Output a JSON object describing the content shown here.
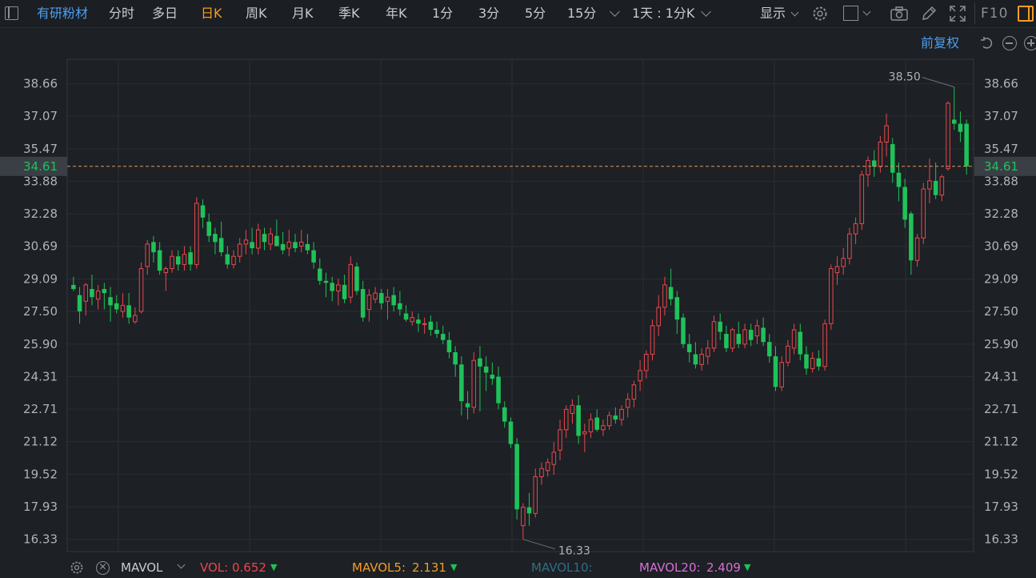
{
  "toolbar": {
    "stock_name": "有研粉材",
    "periods": [
      "分时",
      "多日",
      "日K",
      "周K",
      "月K",
      "季K",
      "年K",
      "1分",
      "3分",
      "5分",
      "15分"
    ],
    "active_period": "日K",
    "interval_select": "1天 : 1分K",
    "display_label": "显示",
    "f10_label": "F10",
    "accent_color": "#f39c27"
  },
  "adjust": {
    "label": "前复权"
  },
  "chart_data": {
    "type": "candlestick",
    "ylim": [
      15.73,
      39.86
    ],
    "y_ticks": [
      "38.66",
      "37.07",
      "35.47",
      "33.88",
      "32.28",
      "30.69",
      "29.09",
      "27.50",
      "25.90",
      "24.31",
      "22.71",
      "21.12",
      "19.52",
      "17.93",
      "16.33"
    ],
    "current_price": "34.61",
    "high_label": "38.50",
    "low_label": "16.33",
    "up_color": "#e8484e",
    "down_color": "#1fc25a",
    "candles": [
      [
        28.8,
        29.2,
        28.5,
        28.6
      ],
      [
        28.3,
        28.7,
        26.9,
        27.5
      ],
      [
        28.0,
        28.9,
        27.3,
        28.8
      ],
      [
        28.6,
        29.3,
        27.8,
        28.2
      ],
      [
        28.1,
        28.8,
        27.6,
        28.5
      ],
      [
        28.6,
        28.9,
        27.6,
        28.4
      ],
      [
        28.2,
        28.7,
        27.0,
        27.8
      ],
      [
        27.9,
        28.3,
        27.4,
        27.6
      ],
      [
        27.5,
        28.4,
        27.2,
        27.8
      ],
      [
        27.8,
        28.4,
        26.9,
        27.2
      ],
      [
        27.0,
        27.7,
        26.9,
        27.3
      ],
      [
        27.5,
        29.9,
        27.4,
        29.6
      ],
      [
        29.7,
        31.0,
        29.3,
        30.8
      ],
      [
        30.9,
        31.2,
        29.9,
        30.4
      ],
      [
        30.5,
        30.9,
        29.3,
        29.5
      ],
      [
        29.4,
        29.7,
        28.5,
        29.6
      ],
      [
        29.6,
        30.5,
        29.4,
        30.2
      ],
      [
        30.2,
        30.5,
        29.5,
        29.8
      ],
      [
        29.8,
        30.7,
        29.5,
        30.3
      ],
      [
        30.4,
        30.7,
        29.5,
        29.8
      ],
      [
        29.8,
        33.1,
        29.6,
        32.8
      ],
      [
        32.7,
        33.0,
        31.6,
        32.1
      ],
      [
        31.9,
        32.3,
        30.9,
        31.2
      ],
      [
        31.3,
        31.6,
        30.3,
        30.9
      ],
      [
        31.1,
        31.9,
        30.2,
        30.4
      ],
      [
        30.3,
        30.7,
        29.6,
        29.8
      ],
      [
        29.8,
        30.5,
        29.6,
        30.2
      ],
      [
        30.2,
        31.1,
        29.9,
        30.8
      ],
      [
        30.8,
        31.5,
        30.3,
        31.0
      ],
      [
        30.9,
        31.6,
        30.3,
        30.6
      ],
      [
        30.6,
        31.8,
        30.3,
        31.5
      ],
      [
        31.3,
        31.6,
        30.5,
        30.9
      ],
      [
        30.8,
        31.6,
        30.5,
        31.3
      ],
      [
        31.2,
        32.0,
        30.9,
        30.7
      ],
      [
        30.8,
        31.4,
        30.3,
        30.5
      ],
      [
        30.6,
        31.5,
        30.2,
        30.9
      ],
      [
        30.9,
        31.3,
        30.4,
        30.6
      ],
      [
        30.7,
        31.5,
        30.4,
        30.9
      ],
      [
        30.8,
        31.3,
        30.3,
        30.5
      ],
      [
        30.5,
        30.9,
        29.6,
        29.9
      ],
      [
        29.6,
        30.1,
        28.8,
        29.0
      ],
      [
        29.0,
        29.4,
        28.2,
        28.9
      ],
      [
        28.9,
        29.2,
        28.0,
        28.5
      ],
      [
        28.5,
        29.1,
        27.8,
        28.8
      ],
      [
        28.8,
        29.3,
        27.9,
        28.1
      ],
      [
        28.2,
        30.2,
        27.9,
        29.8
      ],
      [
        29.7,
        29.9,
        28.3,
        28.5
      ],
      [
        28.6,
        29.0,
        27.0,
        27.2
      ],
      [
        27.6,
        28.6,
        27.0,
        28.3
      ],
      [
        28.1,
        28.7,
        27.9,
        28.4
      ],
      [
        28.4,
        28.6,
        27.6,
        27.9
      ],
      [
        28.0,
        28.6,
        27.1,
        28.2
      ],
      [
        28.3,
        28.7,
        27.5,
        27.8
      ],
      [
        27.9,
        28.5,
        27.3,
        27.6
      ],
      [
        27.4,
        27.8,
        27.0,
        27.1
      ],
      [
        27.0,
        27.5,
        26.8,
        27.2
      ],
      [
        27.1,
        27.4,
        26.5,
        26.9
      ],
      [
        26.9,
        27.2,
        26.4,
        26.9
      ],
      [
        27.0,
        27.3,
        26.3,
        26.6
      ],
      [
        26.6,
        27.0,
        26.2,
        26.4
      ],
      [
        26.4,
        26.8,
        25.9,
        26.1
      ],
      [
        26.1,
        26.5,
        25.2,
        25.5
      ],
      [
        25.5,
        25.8,
        24.3,
        24.9
      ],
      [
        24.9,
        25.3,
        22.4,
        23.1
      ],
      [
        23.0,
        23.6,
        22.2,
        22.8
      ],
      [
        22.8,
        25.5,
        22.5,
        25.1
      ],
      [
        25.2,
        25.8,
        22.6,
        24.8
      ],
      [
        24.8,
        25.3,
        23.6,
        24.5
      ],
      [
        24.4,
        25.0,
        23.9,
        24.2
      ],
      [
        24.3,
        24.8,
        22.7,
        23.0
      ],
      [
        22.8,
        23.1,
        21.8,
        22.1
      ],
      [
        22.1,
        22.3,
        20.8,
        21.0
      ],
      [
        21.0,
        21.3,
        17.3,
        17.8
      ],
      [
        17.0,
        18.1,
        16.33,
        17.9
      ],
      [
        17.9,
        18.6,
        17.0,
        17.6
      ],
      [
        17.6,
        19.8,
        17.4,
        19.4
      ],
      [
        19.4,
        20.1,
        19.0,
        19.8
      ],
      [
        19.7,
        20.3,
        19.4,
        20.1
      ],
      [
        20.0,
        21.1,
        19.5,
        20.6
      ],
      [
        20.7,
        22.2,
        20.2,
        21.7
      ],
      [
        21.7,
        22.9,
        21.3,
        22.7
      ],
      [
        22.5,
        23.2,
        22.0,
        22.9
      ],
      [
        22.9,
        23.4,
        21.0,
        21.4
      ],
      [
        21.5,
        22.0,
        20.6,
        21.6
      ],
      [
        21.6,
        22.5,
        21.3,
        22.2
      ],
      [
        22.3,
        22.7,
        21.6,
        21.7
      ],
      [
        21.7,
        22.2,
        21.4,
        21.9
      ],
      [
        21.9,
        22.6,
        21.7,
        22.4
      ],
      [
        22.4,
        22.8,
        22.0,
        22.2
      ],
      [
        22.2,
        22.9,
        21.9,
        22.7
      ],
      [
        22.8,
        23.5,
        22.3,
        23.2
      ],
      [
        23.2,
        24.1,
        22.8,
        23.9
      ],
      [
        24.1,
        25.1,
        23.6,
        24.6
      ],
      [
        24.6,
        25.6,
        24.2,
        25.4
      ],
      [
        25.4,
        27.1,
        25.1,
        26.8
      ],
      [
        26.8,
        28.3,
        26.3,
        27.7
      ],
      [
        27.7,
        29.2,
        27.3,
        28.8
      ],
      [
        28.7,
        29.6,
        27.8,
        28.1
      ],
      [
        28.2,
        28.5,
        26.4,
        27.1
      ],
      [
        27.2,
        27.4,
        25.7,
        25.9
      ],
      [
        25.9,
        26.4,
        25.0,
        25.5
      ],
      [
        25.4,
        26.0,
        24.7,
        24.9
      ],
      [
        24.9,
        25.7,
        24.6,
        25.4
      ],
      [
        25.3,
        26.1,
        24.9,
        25.7
      ],
      [
        25.7,
        27.3,
        25.5,
        27.0
      ],
      [
        27.0,
        27.4,
        26.1,
        26.5
      ],
      [
        26.4,
        26.8,
        25.5,
        25.7
      ],
      [
        25.7,
        26.7,
        25.5,
        26.6
      ],
      [
        26.4,
        27.0,
        25.7,
        25.9
      ],
      [
        25.9,
        26.9,
        25.7,
        26.6
      ],
      [
        26.6,
        26.9,
        25.8,
        26.1
      ],
      [
        26.3,
        27.1,
        25.9,
        26.8
      ],
      [
        26.7,
        27.2,
        25.8,
        26.0
      ],
      [
        26.0,
        26.4,
        25.0,
        25.3
      ],
      [
        25.3,
        25.8,
        23.6,
        23.8
      ],
      [
        23.8,
        25.3,
        23.6,
        25.0
      ],
      [
        25.0,
        26.1,
        24.8,
        25.8
      ],
      [
        25.7,
        26.9,
        25.4,
        26.6
      ],
      [
        26.5,
        26.9,
        25.1,
        25.4
      ],
      [
        25.4,
        25.8,
        24.4,
        24.7
      ],
      [
        24.7,
        25.5,
        24.5,
        25.2
      ],
      [
        25.2,
        25.6,
        24.6,
        24.8
      ],
      [
        24.8,
        27.1,
        24.6,
        26.9
      ],
      [
        26.9,
        29.8,
        26.6,
        29.6
      ],
      [
        29.4,
        30.2,
        28.8,
        29.7
      ],
      [
        29.7,
        30.6,
        29.3,
        30.1
      ],
      [
        30.1,
        31.6,
        29.8,
        31.3
      ],
      [
        31.3,
        32.1,
        30.8,
        31.8
      ],
      [
        31.8,
        34.4,
        31.5,
        34.2
      ],
      [
        34.2,
        35.1,
        33.6,
        34.9
      ],
      [
        34.9,
        35.4,
        34.1,
        34.6
      ],
      [
        34.6,
        36.1,
        34.3,
        35.8
      ],
      [
        35.8,
        37.2,
        35.1,
        36.6
      ],
      [
        35.7,
        36.0,
        33.8,
        34.3
      ],
      [
        34.3,
        34.8,
        32.9,
        33.6
      ],
      [
        33.6,
        34.0,
        31.6,
        32.0
      ],
      [
        32.3,
        32.4,
        29.3,
        30.0
      ],
      [
        30.0,
        31.3,
        29.7,
        31.1
      ],
      [
        31.1,
        33.8,
        30.8,
        33.5
      ],
      [
        33.5,
        35.0,
        32.8,
        33.9
      ],
      [
        33.9,
        34.8,
        33.0,
        33.2
      ],
      [
        33.2,
        34.2,
        32.9,
        34.1
      ],
      [
        34.5,
        37.8,
        34.4,
        37.7
      ],
      [
        36.9,
        38.5,
        36.4,
        36.7
      ],
      [
        36.7,
        37.3,
        35.8,
        36.3
      ],
      [
        36.7,
        36.9,
        34.2,
        34.61
      ]
    ]
  },
  "volume": {
    "indicator": "MAVOL",
    "vol_label": "VOL:",
    "vol_value": "0.652",
    "mavol5_label": "MAVOL5:",
    "mavol5_value": "2.131",
    "mavol10_label": "MAVOL10:",
    "mavol20_label": "MAVOL20:",
    "mavol20_value": "2.409",
    "vol_color": "#e8484e",
    "mavol5_color": "#f39c27",
    "mavol10_color": "#2f6f86",
    "mavol20_color": "#d66fd6",
    "down_arrow_color": "#1fc25a"
  }
}
